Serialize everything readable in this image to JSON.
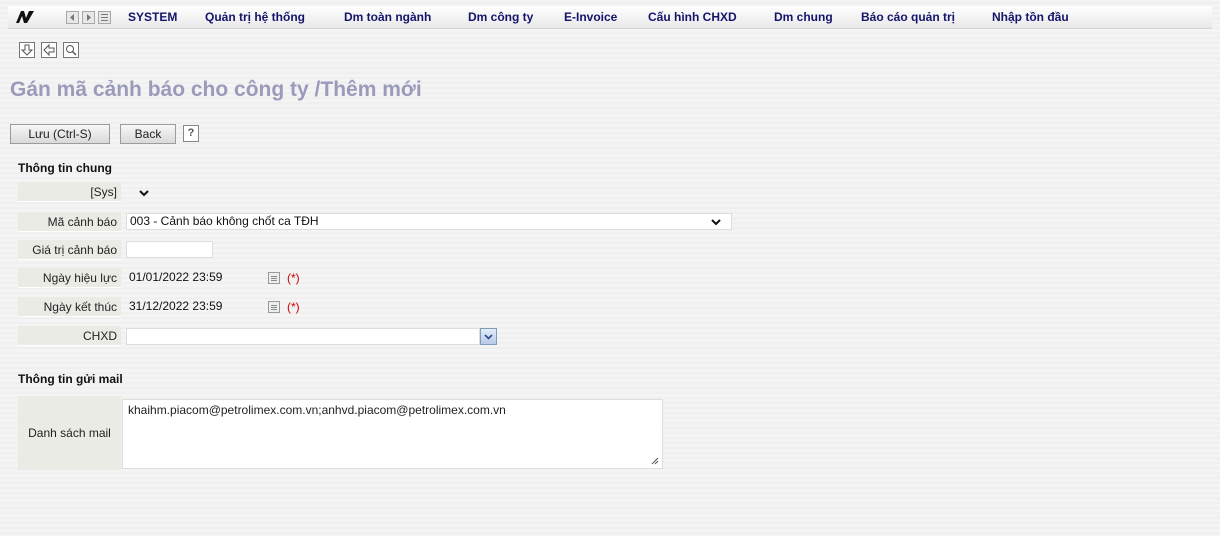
{
  "menu": {
    "items": [
      "SYSTEM",
      "Quản trị hệ thống",
      "Dm toàn ngành",
      "Dm công ty",
      "E-Invoice",
      "Cấu hình CHXD",
      "Dm chung",
      "Báo cáo quản trị",
      "Nhập tồn đầu"
    ],
    "logo_icon": "app-logo-icon",
    "nav_icons": [
      "nav-back-icon",
      "nav-forward-icon",
      "nav-list-icon"
    ]
  },
  "toolbar": {
    "icons": [
      "save-down-icon",
      "back-arrow-icon",
      "search-zoom-icon"
    ]
  },
  "page": {
    "title": "Gán mã cảnh báo cho công ty /Thêm mới"
  },
  "actions": {
    "save_label": "Lưu (Ctrl-S)",
    "back_label": "Back",
    "help_label": "?"
  },
  "general": {
    "section_title": "Thông tin chung",
    "sys_label": "[Sys]",
    "sys_value": "",
    "warning_code_label": "Mã cảnh báo",
    "warning_code_value": "003 - Cảnh báo không chốt ca TĐH",
    "warning_value_label": "Giá trị cảnh báo",
    "warning_value_value": "",
    "effective_date_label": "Ngày hiệu lực",
    "effective_date_value": "01/01/2022 23:59",
    "end_date_label": "Ngày kết thúc",
    "end_date_value": "31/12/2022 23:59",
    "required_mark": "(*)",
    "station_label": "CHXD",
    "station_value": ""
  },
  "mail": {
    "section_title": "Thông tin gửi mail",
    "list_label": "Danh sách mail",
    "list_value": "khaihm.piacom@petrolimex.com.vn;anhvd.piacom@petrolimex.com.vn"
  },
  "colors": {
    "menu_text": "#14146b",
    "title_text": "#9a9abb",
    "required": "#d00000",
    "label_bg": "#ebebe6"
  }
}
